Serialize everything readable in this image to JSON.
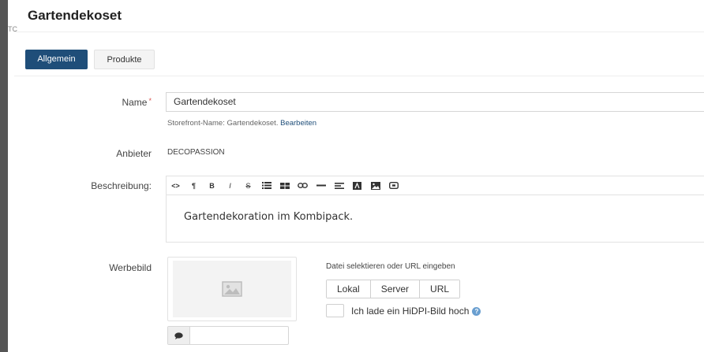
{
  "left_tab": {
    "label": "TC"
  },
  "page": {
    "title": "Gartendekoset"
  },
  "tabs": [
    {
      "label": "Allgemein",
      "active": true
    },
    {
      "label": "Produkte",
      "active": false
    }
  ],
  "form": {
    "name": {
      "label": "Name",
      "required_marker": "*",
      "value": "Gartendekoset"
    },
    "storefront": {
      "text": "Storefront-Name: Gartendekoset.",
      "edit_link": "Bearbeiten"
    },
    "vendor": {
      "label": "Anbieter",
      "value": "DECOPASSION"
    },
    "description": {
      "label": "Beschreibung:",
      "toolbar": [
        "code-icon",
        "paragraph-icon",
        "bold-icon",
        "italic-icon",
        "strikethrough-icon",
        "unordered-list-icon",
        "table-icon",
        "link-icon",
        "horizontal-rule-icon",
        "align-icon",
        "font-color-icon",
        "image-icon",
        "video-icon"
      ],
      "toolbar_glyphs": {
        "code": "<>",
        "paragraph": "¶",
        "bold": "B",
        "italic": "I",
        "strike": "S"
      },
      "content": "Gartendekoration im Kombipack."
    },
    "image": {
      "label": "Werbebild",
      "hint": "Datei selektieren oder URL eingeben",
      "sources": [
        "Lokal",
        "Server",
        "URL"
      ],
      "hidpi_label": "Ich lade ein HiDPI-Bild hoch"
    }
  },
  "colors": {
    "primary": "#1f4e79",
    "required": "#d9534f",
    "help": "#6a9fd0"
  }
}
